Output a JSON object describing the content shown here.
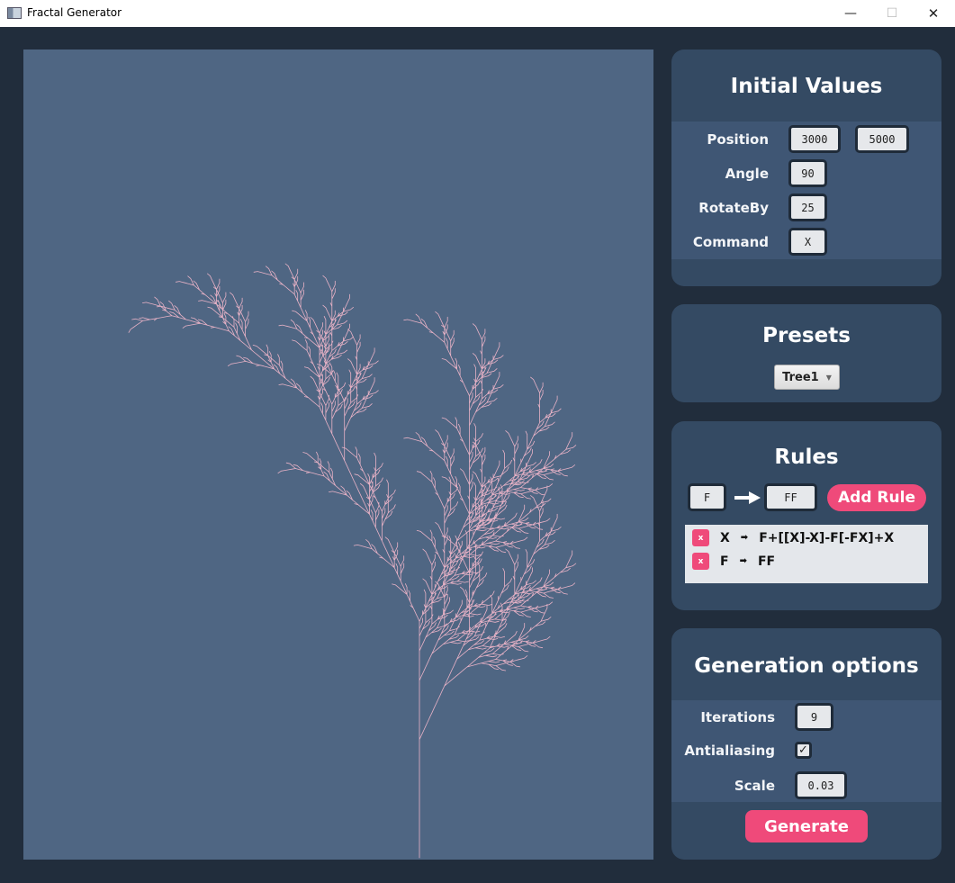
{
  "window": {
    "title": "Fractal Generator",
    "minimize": "—",
    "maximize": "☐",
    "close": "✕"
  },
  "colors": {
    "background": "#212d3c",
    "canvas": "#4f6683",
    "panel": "#344a63",
    "band": "#3f5674",
    "accent": "#ef4a7a",
    "fractal": "#e8b2c6"
  },
  "initial_values": {
    "title": "Initial Values",
    "position_label": "Position",
    "position_x": "3000",
    "position_y": "5000",
    "angle_label": "Angle",
    "angle": "90",
    "rotate_label": "RotateBy",
    "rotate": "25",
    "command_label": "Command",
    "command": "X"
  },
  "presets": {
    "title": "Presets",
    "selected": "Tree1"
  },
  "rules": {
    "title": "Rules",
    "input_from": "F",
    "input_to": "FF",
    "add_label": "Add Rule",
    "items": [
      {
        "remove": "x",
        "from": "X",
        "to": "F+[[X]-X]-F[-FX]+X"
      },
      {
        "remove": "x",
        "from": "F",
        "to": "FF"
      }
    ]
  },
  "generation": {
    "title": "Generation options",
    "iterations_label": "Iterations",
    "iterations": "9",
    "antialiasing_label": "Antialiasing",
    "antialiasing": true,
    "scale_label": "Scale",
    "scale": "0.03",
    "generate_label": "Generate"
  }
}
